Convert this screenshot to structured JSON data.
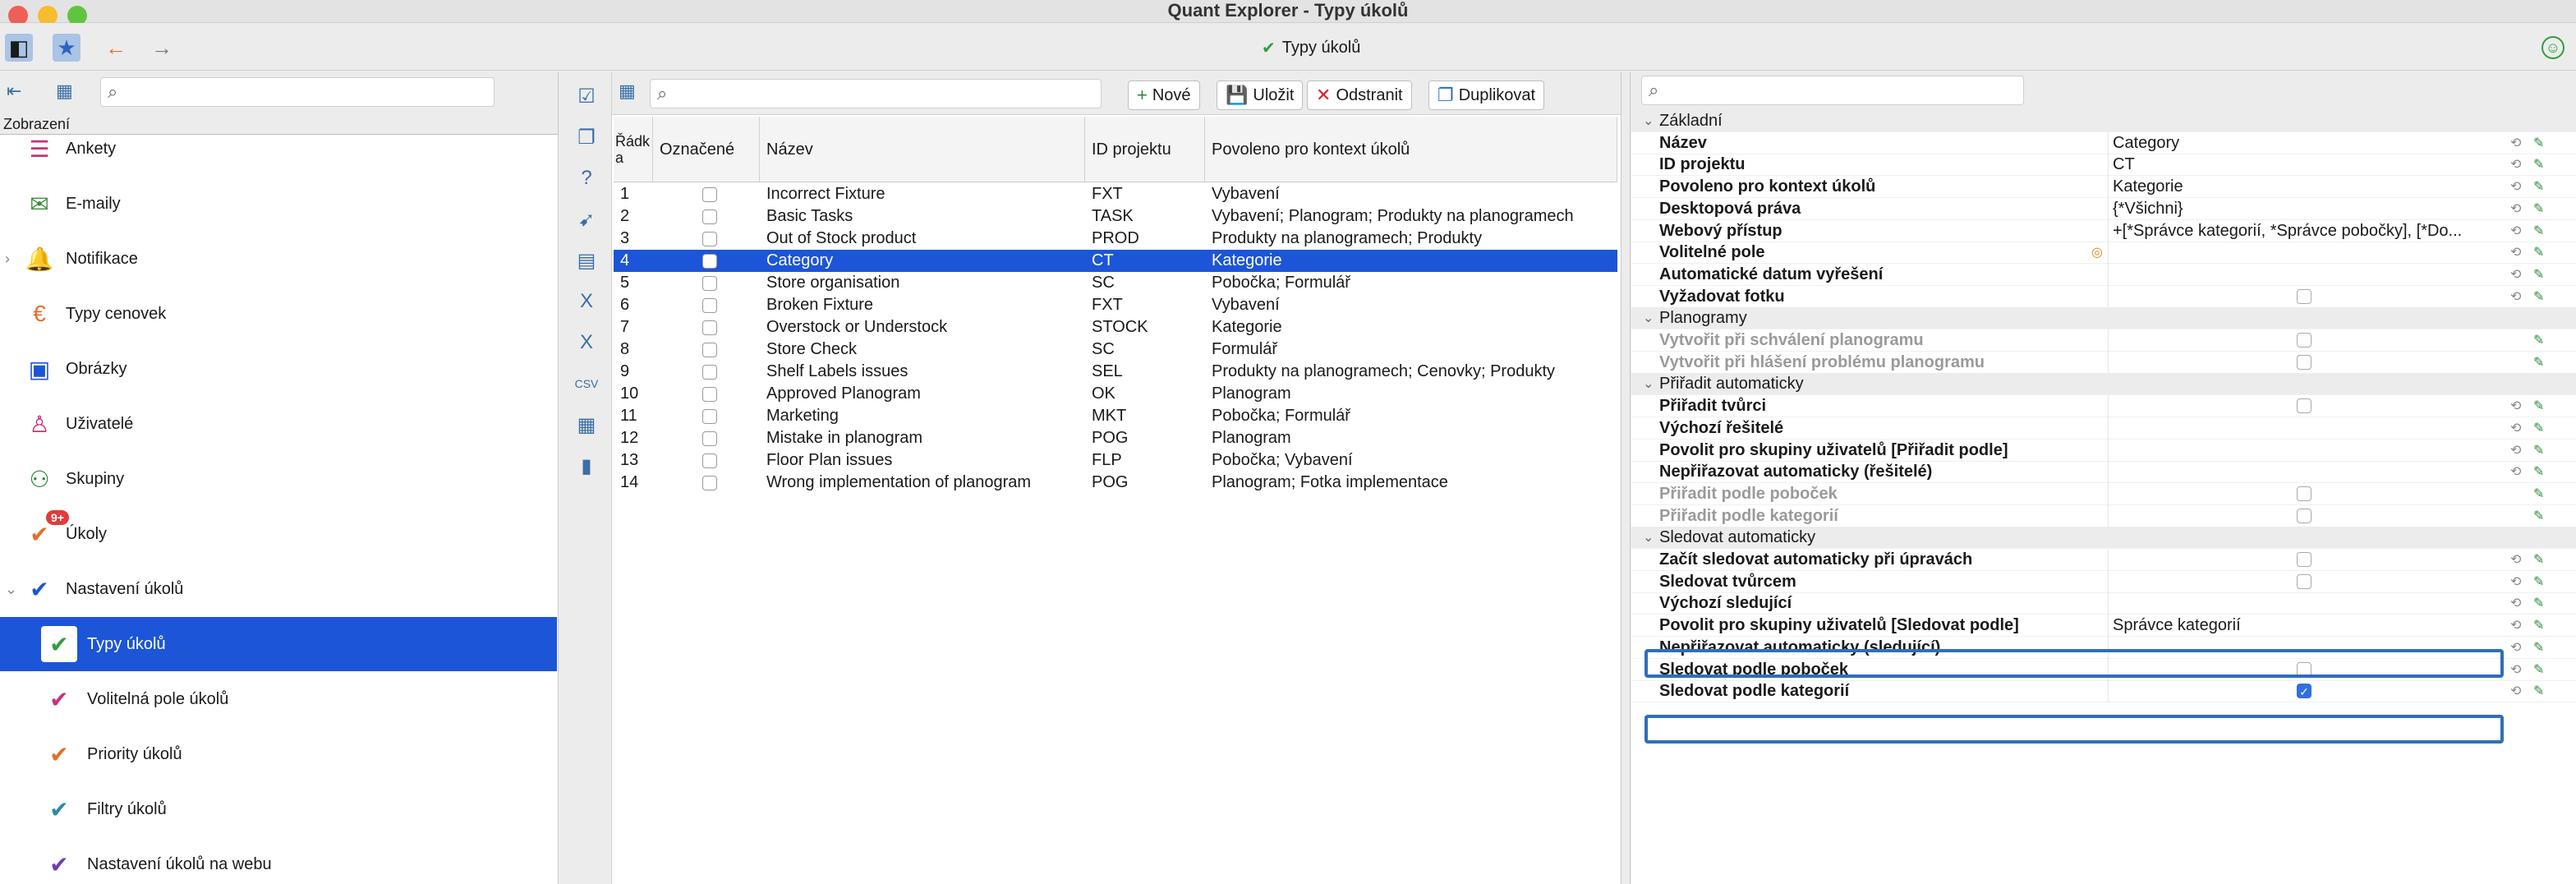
{
  "window": {
    "title": "Quant Explorer - Typy úkolů"
  },
  "toolbar": {
    "title": "Typy úkolů"
  },
  "sidebar": {
    "header": "Zobrazení",
    "items": [
      {
        "label": "Ankety",
        "icon": "survey-icon",
        "level": "top",
        "arrow": ""
      },
      {
        "label": "E-maily",
        "icon": "email-icon",
        "level": "top",
        "arrow": ""
      },
      {
        "label": "Notifikace",
        "icon": "bell-icon",
        "level": "top",
        "arrow": "›"
      },
      {
        "label": "Typy cenovek",
        "icon": "price-tag-icon",
        "level": "top",
        "arrow": ""
      },
      {
        "label": "Obrázky",
        "icon": "image-icon",
        "level": "top",
        "arrow": ""
      },
      {
        "label": "Uživatelé",
        "icon": "user-icon",
        "level": "top",
        "arrow": ""
      },
      {
        "label": "Skupiny",
        "icon": "group-icon",
        "level": "top",
        "arrow": ""
      },
      {
        "label": "Úkoly",
        "icon": "task-icon",
        "level": "top",
        "arrow": "",
        "badge": "9+"
      },
      {
        "label": "Nastavení úkolů",
        "icon": "task-settings-icon",
        "level": "top",
        "arrow": "⌄"
      },
      {
        "label": "Typy úkolů",
        "icon": "task-types-icon",
        "level": "sub",
        "arrow": "",
        "selected": true
      },
      {
        "label": "Volitelná pole úkolů",
        "icon": "task-fields-icon",
        "level": "sub",
        "arrow": ""
      },
      {
        "label": "Priority úkolů",
        "icon": "task-priority-icon",
        "level": "sub",
        "arrow": ""
      },
      {
        "label": "Filtry úkolů",
        "icon": "task-filter-icon",
        "level": "sub",
        "arrow": ""
      },
      {
        "label": "Nastavení úkolů na webu",
        "icon": "task-web-icon",
        "level": "sub",
        "arrow": ""
      }
    ]
  },
  "middle": {
    "buttons": {
      "new": "Nové",
      "save": "Uložit",
      "delete": "Odstranit",
      "duplicate": "Duplikovat"
    },
    "columns": {
      "row": "Řádk\na",
      "marked": "Označené",
      "name": "Název",
      "project": "ID projektu",
      "context": "Povoleno pro kontext úkolů"
    },
    "rows": [
      {
        "n": "1",
        "name": "Incorrect Fixture",
        "id": "FXT",
        "ctx": "Vybavení"
      },
      {
        "n": "2",
        "name": "Basic Tasks",
        "id": "TASK",
        "ctx": "Vybavení; Planogram; Produkty na planogramech"
      },
      {
        "n": "3",
        "name": "Out of Stock product",
        "id": "PROD",
        "ctx": "Produkty na planogramech; Produkty"
      },
      {
        "n": "4",
        "name": "Category",
        "id": "CT",
        "ctx": "Kategorie",
        "selected": true
      },
      {
        "n": "5",
        "name": "Store organisation",
        "id": "SC",
        "ctx": "Pobočka; Formulář"
      },
      {
        "n": "6",
        "name": "Broken Fixture",
        "id": "FXT",
        "ctx": "Vybavení"
      },
      {
        "n": "7",
        "name": "Overstock or Understock",
        "id": "STOCK",
        "ctx": "Kategorie"
      },
      {
        "n": "8",
        "name": "Store Check",
        "id": "SC",
        "ctx": "Formulář"
      },
      {
        "n": "9",
        "name": "Shelf Labels issues",
        "id": "SEL",
        "ctx": "Produkty na planogramech; Cenovky; Produkty"
      },
      {
        "n": "10",
        "name": "Approved Planogram",
        "id": "OK",
        "ctx": "Planogram"
      },
      {
        "n": "11",
        "name": "Marketing",
        "id": "MKT",
        "ctx": "Pobočka; Formulář"
      },
      {
        "n": "12",
        "name": "Mistake in planogram",
        "id": "POG",
        "ctx": "Planogram"
      },
      {
        "n": "13",
        "name": "Floor Plan issues",
        "id": "FLP",
        "ctx": "Pobočka; Vybavení"
      },
      {
        "n": "14",
        "name": "Wrong implementation of planogram",
        "id": "POG",
        "ctx": "Planogram; Fotka implementace"
      }
    ]
  },
  "properties": {
    "rows": [
      {
        "type": "section",
        "name": "Základní"
      },
      {
        "type": "prop",
        "name": "Název",
        "value": "Category"
      },
      {
        "type": "prop",
        "name": "ID projektu",
        "value": "CT"
      },
      {
        "type": "prop",
        "name": "Povoleno pro kontext úkolů",
        "value": "Kategorie"
      },
      {
        "type": "prop",
        "name": "Desktopová práva",
        "value": "{*Všichni}"
      },
      {
        "type": "prop",
        "name": "Webový přístup",
        "value": "+[*Správce kategorií, *Správce pobočky], [*Do..."
      },
      {
        "type": "prop",
        "name": "Volitelné pole",
        "value": "",
        "orange": true
      },
      {
        "type": "prop",
        "name": "Automatické datum vyřešení",
        "value": ""
      },
      {
        "type": "prop",
        "name": "Vyžadovat fotku",
        "checkbox": "unchecked"
      },
      {
        "type": "section",
        "name": "Planogramy"
      },
      {
        "type": "prop",
        "name": "Vytvořit při schválení planogramu",
        "checkbox": "unchecked",
        "disabled": true
      },
      {
        "type": "prop",
        "name": "Vytvořit při hlášení problému planogramu",
        "checkbox": "unchecked",
        "disabled": true
      },
      {
        "type": "section",
        "name": "Přiřadit automaticky"
      },
      {
        "type": "prop",
        "name": "Přiřadit tvůrci",
        "checkbox": "unchecked"
      },
      {
        "type": "prop",
        "name": "Výchozí řešitelé",
        "value": ""
      },
      {
        "type": "prop",
        "name": "Povolit pro skupiny uživatelů [Přiřadit podle]",
        "value": ""
      },
      {
        "type": "prop",
        "name": "Nepřiřazovat automaticky (řešitelé)",
        "value": ""
      },
      {
        "type": "prop",
        "name": "Přiřadit podle poboček",
        "checkbox": "unchecked",
        "disabled": true
      },
      {
        "type": "prop",
        "name": "Přiřadit podle kategorií",
        "checkbox": "unchecked",
        "disabled": true
      },
      {
        "type": "section",
        "name": "Sledovat automaticky"
      },
      {
        "type": "prop",
        "name": "Začít sledovat automaticky při úpravách",
        "checkbox": "unchecked"
      },
      {
        "type": "prop",
        "name": "Sledovat tvůrcem",
        "checkbox": "unchecked"
      },
      {
        "type": "prop",
        "name": "Výchozí sledující",
        "value": ""
      },
      {
        "type": "prop",
        "name": "Povolit pro skupiny uživatelů [Sledovat podle]",
        "value": "Správce kategorií",
        "highlight": true
      },
      {
        "type": "prop",
        "name": "Nepřiřazovat automaticky (sledující)",
        "value": ""
      },
      {
        "type": "prop",
        "name": "Sledovat podle poboček",
        "checkbox": "unchecked"
      },
      {
        "type": "prop",
        "name": "Sledovat podle kategorií",
        "checkbox": "checked",
        "highlight": true
      }
    ]
  }
}
